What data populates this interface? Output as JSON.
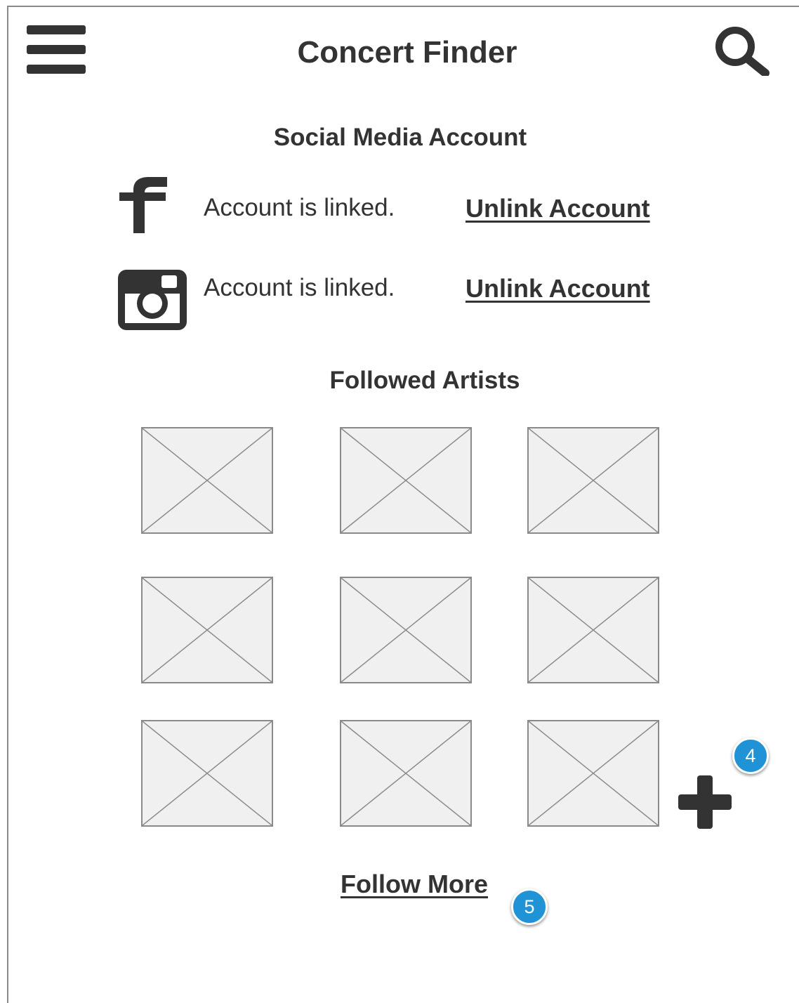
{
  "header": {
    "title": "Concert Finder",
    "menu_icon": "hamburger-menu-icon",
    "search_icon": "search-icon"
  },
  "social": {
    "heading": "Social Media Account",
    "accounts": [
      {
        "icon": "facebook-icon",
        "status": "Account is linked.",
        "action": "Unlink Account"
      },
      {
        "icon": "instagram-icon",
        "status": "Account is linked.",
        "action": "Unlink Account"
      }
    ]
  },
  "artists": {
    "heading": "Followed Artists",
    "add_icon": "plus-icon"
  },
  "follow_more": "Follow More",
  "annotations": {
    "badge_4": "4",
    "badge_5": "5"
  },
  "colors": {
    "text": "#333333",
    "badge": "#1f93d6",
    "placeholder_fill": "#f0f0f0",
    "placeholder_stroke": "#8a8a8a"
  }
}
